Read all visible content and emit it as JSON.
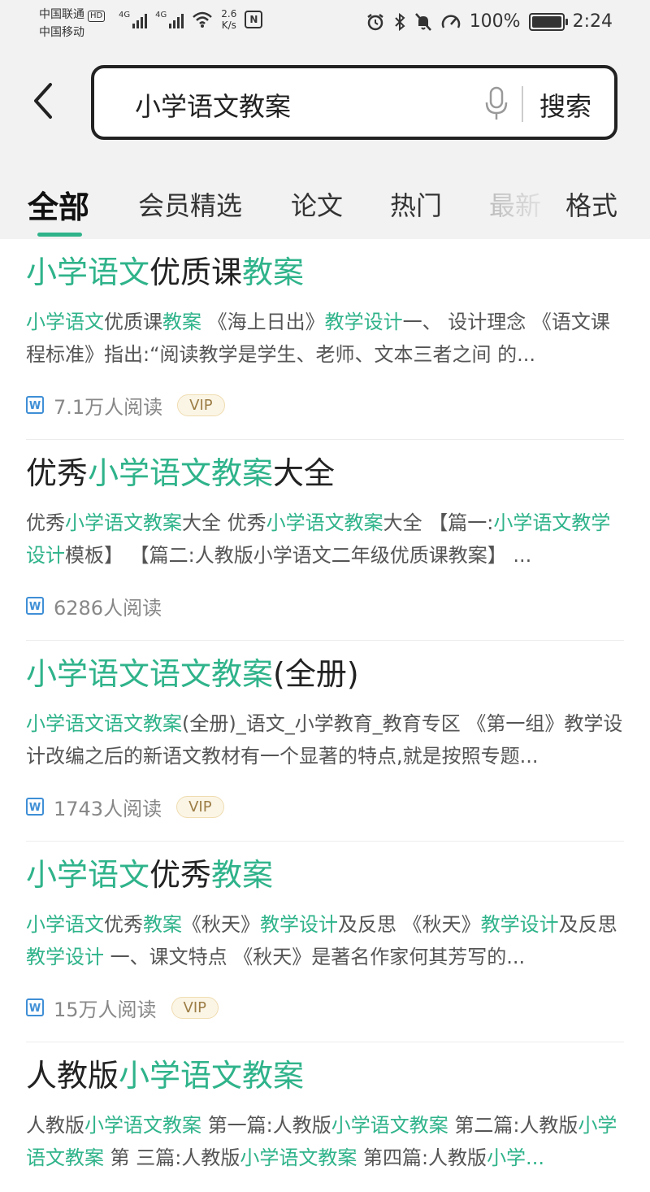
{
  "status_bar": {
    "carrier1": "中国联通",
    "hd_badge": "HD",
    "carrier2": "中国移动",
    "net1": "4G",
    "net2": "4G",
    "speed_value": "2.6",
    "speed_unit": "K/s",
    "nfc": "N",
    "battery_percent": "100%",
    "time": "2:24"
  },
  "search": {
    "query": "小学语文教案",
    "button_label": "搜索"
  },
  "tabs": [
    {
      "label": "全部",
      "active": true
    },
    {
      "label": "会员精选"
    },
    {
      "label": "论文"
    },
    {
      "label": "热门"
    },
    {
      "label": "最新"
    },
    {
      "label": "格式"
    }
  ],
  "colors": {
    "accent": "#2fb38a"
  },
  "results": [
    {
      "title": [
        {
          "text": "小学语文",
          "hl": true
        },
        {
          "text": "优质课",
          "hl": false
        },
        {
          "text": "教案",
          "hl": true
        }
      ],
      "snippet": [
        {
          "text": "小学语文",
          "hl": true
        },
        {
          "text": "优质课",
          "hl": false
        },
        {
          "text": "教案",
          "hl": true
        },
        {
          "text": " 《海上日出》",
          "hl": false
        },
        {
          "text": "教学设计",
          "hl": true
        },
        {
          "text": "一、 设计理念 《语文课程标准》指出:“阅读教学是学生、老师、文本三者之间 的...",
          "hl": false
        }
      ],
      "reads": "7.1万人阅读",
      "vip": "VIP"
    },
    {
      "title": [
        {
          "text": "优秀",
          "hl": false
        },
        {
          "text": "小学语文教案",
          "hl": true
        },
        {
          "text": "大全",
          "hl": false
        }
      ],
      "snippet": [
        {
          "text": "优秀",
          "hl": false
        },
        {
          "text": "小学语文教案",
          "hl": true
        },
        {
          "text": "大全 优秀",
          "hl": false
        },
        {
          "text": "小学语文教案",
          "hl": true
        },
        {
          "text": "大全 【篇一:",
          "hl": false
        },
        {
          "text": "小学语文教学设计",
          "hl": true
        },
        {
          "text": "模板】 【篇二:人教版小学语文二年级优质课教案】 ...",
          "hl": false
        }
      ],
      "reads": "6286人阅读",
      "vip": ""
    },
    {
      "title": [
        {
          "text": "小学语文语文教案",
          "hl": true
        },
        {
          "text": "(全册)",
          "hl": false
        }
      ],
      "snippet": [
        {
          "text": "小学语文语文教案",
          "hl": true
        },
        {
          "text": "(全册)_语文_小学教育_教育专区 《第一组》教学设计改编之后的新语文教材有一个显著的特点,就是按照专题...",
          "hl": false
        }
      ],
      "reads": "1743人阅读",
      "vip": "VIP"
    },
    {
      "title": [
        {
          "text": "小学语文",
          "hl": true
        },
        {
          "text": "优秀",
          "hl": false
        },
        {
          "text": "教案",
          "hl": true
        }
      ],
      "snippet": [
        {
          "text": "小学语文",
          "hl": true
        },
        {
          "text": "优秀",
          "hl": false
        },
        {
          "text": "教案",
          "hl": true
        },
        {
          "text": "《秋天》",
          "hl": false
        },
        {
          "text": "教学设计",
          "hl": true
        },
        {
          "text": "及反思 《秋天》",
          "hl": false
        },
        {
          "text": "教学设计",
          "hl": true
        },
        {
          "text": "及反思 ",
          "hl": false
        },
        {
          "text": "教学设计",
          "hl": true
        },
        {
          "text": " 一、课文特点 《秋天》是著名作家何其芳写的...",
          "hl": false
        }
      ],
      "reads": "15万人阅读",
      "vip": "VIP"
    },
    {
      "title": [
        {
          "text": "人教版",
          "hl": false
        },
        {
          "text": "小学语文教案",
          "hl": true
        }
      ],
      "snippet": [
        {
          "text": "人教版",
          "hl": false
        },
        {
          "text": "小学语文教案",
          "hl": true
        },
        {
          "text": " 第一篇:人教版",
          "hl": false
        },
        {
          "text": "小学语文教案",
          "hl": true
        },
        {
          "text": " 第二篇:人教版",
          "hl": false
        },
        {
          "text": "小学语文教案",
          "hl": true
        },
        {
          "text": " 第 三篇:人教版",
          "hl": false
        },
        {
          "text": "小学语文教案",
          "hl": true
        },
        {
          "text": " 第四篇:人教版",
          "hl": false
        },
        {
          "text": "小学...",
          "hl": true
        }
      ],
      "reads": "",
      "vip": ""
    }
  ]
}
